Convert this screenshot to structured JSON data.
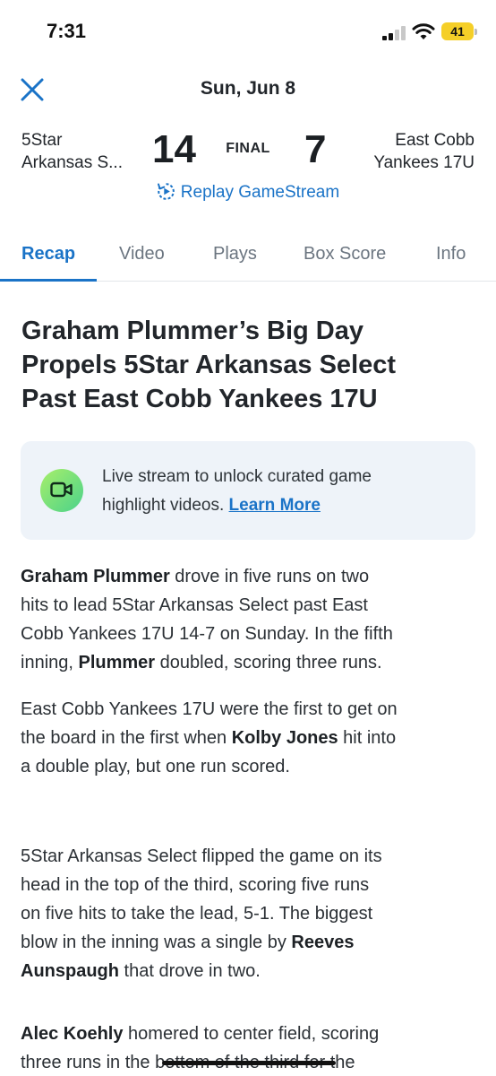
{
  "status_bar": {
    "time": "7:31",
    "battery": "41"
  },
  "header": {
    "date": "Sun, Jun 8",
    "home_team_line1": "5Star",
    "home_team_line2": "Arkansas S...",
    "home_score": "14",
    "status": "FINAL",
    "away_score": "7",
    "away_team_line1": "East Cobb",
    "away_team_line2": "Yankees 17U",
    "replay_label": "Replay GameStream"
  },
  "tabs": [
    "Recap",
    "Video",
    "Plays",
    "Box Score",
    "Info"
  ],
  "active_tab": "Recap",
  "article": {
    "headline_line1": "Graham Plummer’s Big Day",
    "headline_line2": "Propels 5Star Arkansas Select",
    "headline_line3": "Past East Cobb Yankees 17U",
    "banner_text_line1": "Live stream to unlock curated game",
    "banner_text_line2": "highlight videos.",
    "banner_link": "Learn More",
    "p1": {
      "l1_bold": "Graham Plummer",
      "l1_rest": " drove in five runs on two",
      "l2": "hits to lead 5Star Arkansas Select past East",
      "l3": "Cobb Yankees 17U 14-7 on Sunday. In the fifth",
      "l4_a": "inning, ",
      "l4_bold": "Plummer",
      "l4_b": " doubled, scoring three runs."
    },
    "p2": {
      "l1": "East Cobb Yankees 17U were the first to get on",
      "l2_a": "the board in the first when ",
      "l2_bold": "Kolby Jones",
      "l2_b": " hit into",
      "l3": "a double play, but one run scored."
    },
    "p3": {
      "l1": "5Star Arkansas Select flipped the game on its",
      "l2": "head in the top of the third, scoring five runs",
      "l3": "on five hits to take the lead, 5-1. The biggest",
      "l4_a": "blow in the inning was a single by ",
      "l4_bold": "Reeves",
      "l5_bold": "Aunspaugh",
      "l5_b": " that drove in two."
    },
    "p4": {
      "l1_bold": "Alec Koehly",
      "l1_rest": " homered to center field, scoring",
      "l2": "three runs in the bottom of the third for the"
    }
  },
  "colors": {
    "accent": "#1a73c7",
    "banner_bg": "#eef3f9",
    "battery": "#f5cf28"
  },
  "icons": {
    "close": "close-icon",
    "replay": "replay-icon",
    "video": "video-camera-icon"
  }
}
